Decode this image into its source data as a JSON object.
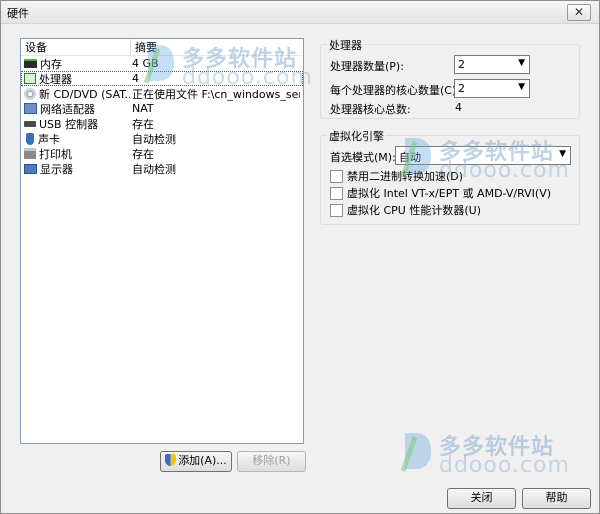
{
  "window": {
    "title": "硬件",
    "close_glyph": "✕"
  },
  "device_list": {
    "headers": {
      "device": "设备",
      "summary": "摘要"
    },
    "rows": [
      {
        "icon": "memory-icon",
        "device": "内存",
        "summary": "4 GB"
      },
      {
        "icon": "processor-icon",
        "device": "处理器",
        "summary": "4"
      },
      {
        "icon": "cd-dvd-icon",
        "device": "新 CD/DVD (SAT...",
        "summary": "正在使用文件 F:\\cn_windows_serve..."
      },
      {
        "icon": "network-adapter-icon",
        "device": "网络适配器",
        "summary": "NAT"
      },
      {
        "icon": "usb-controller-icon",
        "device": "USB 控制器",
        "summary": "存在"
      },
      {
        "icon": "sound-card-icon",
        "device": "声卡",
        "summary": "自动检测"
      },
      {
        "icon": "printer-icon",
        "device": "打印机",
        "summary": "存在"
      },
      {
        "icon": "display-icon",
        "device": "显示器",
        "summary": "自动检测"
      }
    ],
    "selected_index": 1
  },
  "buttons": {
    "add": "添加(A)...",
    "remove": "移除(R)",
    "close": "关闭",
    "help": "帮助"
  },
  "processors": {
    "group_title": "处理器",
    "count_label": "处理器数量(P):",
    "count_value": "2",
    "cores_label": "每个处理器的核心数量(C):",
    "cores_value": "2",
    "total_label": "处理器核心总数:",
    "total_value": "4"
  },
  "virtualization": {
    "group_title": "虚拟化引擎",
    "mode_label": "首选模式(M):",
    "mode_value": "自动",
    "options": [
      {
        "label": "禁用二进制转换加速(D)",
        "checked": false
      },
      {
        "label": "虚拟化 Intel VT-x/EPT 或 AMD-V/RVI(V)",
        "checked": false
      },
      {
        "label": "虚拟化 CPU 性能计数器(U)",
        "checked": false
      }
    ]
  },
  "watermark": {
    "cn": "多多软件站",
    "en": "ddooo.com"
  }
}
